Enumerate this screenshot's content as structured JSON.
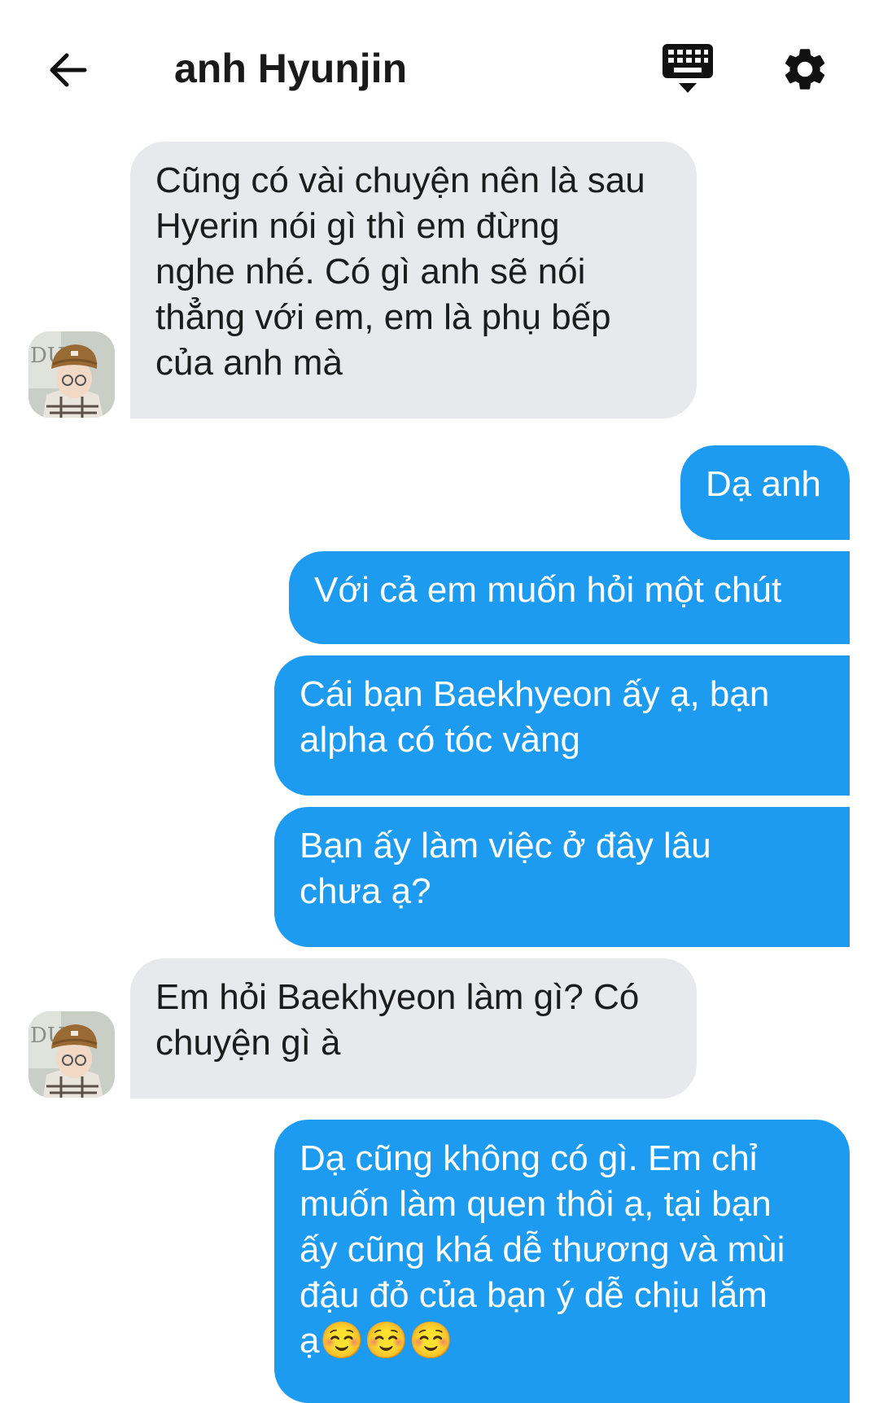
{
  "header": {
    "title": "anh Hyunjin",
    "back_icon": "arrow-left-icon",
    "keyboard_icon": "keyboard-icon",
    "settings_icon": "gear-icon"
  },
  "colors": {
    "outgoing_bubble": "#1d9bf0",
    "incoming_bubble": "#e8e9ec",
    "text_dark": "#1a1a1a"
  },
  "messages": [
    {
      "sender": "anh Hyunjin",
      "direction": "incoming",
      "text": "Cũng có vài chuyện nên là sau\nHyerin nói gì thì em đừng\nnghe nhé. Có gì anh sẽ nói\nthẳng với em, em là phụ bếp\ncủa anh mà"
    },
    {
      "direction": "outgoing",
      "text": "Dạ anh"
    },
    {
      "direction": "outgoing",
      "text": "Với cả em muốn hỏi một chút"
    },
    {
      "direction": "outgoing",
      "text": "Cái bạn Baekhyeon ấy ạ, bạn\nalpha có tóc vàng"
    },
    {
      "direction": "outgoing",
      "text": "Bạn ấy làm việc ở đây lâu\nchưa ạ?"
    },
    {
      "sender": "anh Hyunjin",
      "direction": "incoming",
      "text": "Em hỏi Baekhyeon làm gì? Có\nchuyện gì à"
    },
    {
      "direction": "outgoing",
      "text": "Dạ cũng không có gì. Em chỉ\nmuốn làm quen thôi ạ, tại bạn\nấy cũng khá dễ thương và mùi\nđậu đỏ của bạn ý dễ chịu lắm\nạ☺️☺️☺️"
    }
  ]
}
